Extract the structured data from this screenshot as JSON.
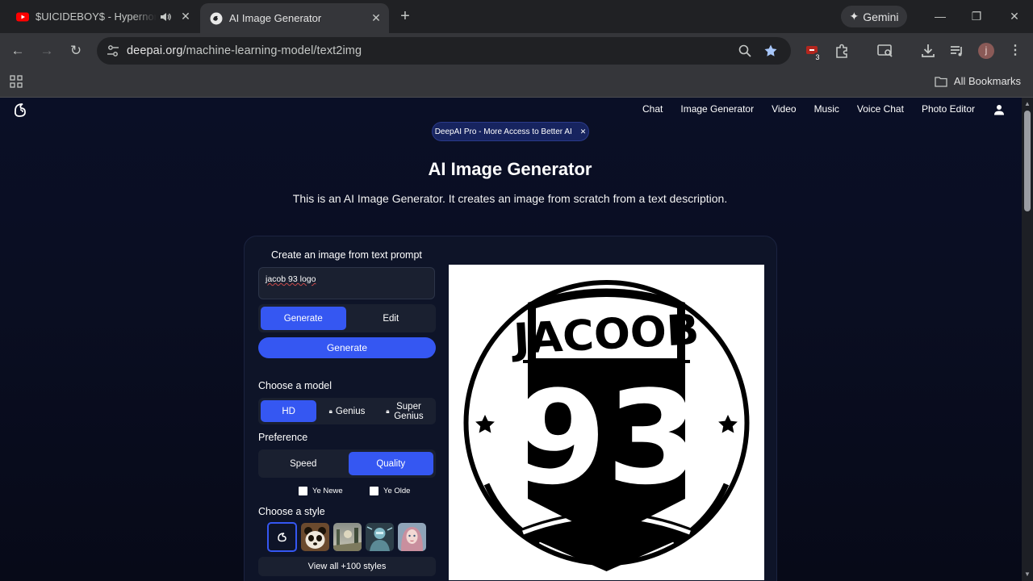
{
  "browser": {
    "tabs": [
      {
        "title": "$UICIDEBOY$ - Hypernormal",
        "active": false,
        "audio": true
      },
      {
        "title": "AI Image Generator",
        "active": true
      }
    ],
    "gemini_label": "Gemini",
    "url_host": "deepai.org",
    "url_path": "/machine-learning-model/text2img",
    "extension_badge": "3",
    "profile_initial": "j",
    "bookmarks_label": "All Bookmarks"
  },
  "site": {
    "nav": [
      "Chat",
      "Image Generator",
      "Video",
      "Music",
      "Voice Chat",
      "Photo Editor"
    ],
    "promo": "DeepAI Pro - More Access to Better AI",
    "title": "AI Image Generator",
    "description": "This is an AI Image Generator. It creates an image from scratch from a text description."
  },
  "generator": {
    "heading": "Create an image from text prompt",
    "prompt_value": "jacob 93 logo",
    "mode_tabs": {
      "generate": "Generate",
      "edit": "Edit"
    },
    "generate_button": "Generate",
    "model_label": "Choose a model",
    "models": {
      "hd": "HD",
      "genius": "Genius",
      "super_genius": "Super Genius"
    },
    "preference_label": "Preference",
    "preferences": {
      "speed": "Speed",
      "quality": "Quality"
    },
    "checkbox_newe": "Ye Newe",
    "checkbox_olde": "Ye Olde",
    "style_label": "Choose a style",
    "view_all": "View all +100 styles"
  },
  "result_image": {
    "banner_text": "JACOOB",
    "number_text": "93"
  },
  "colors": {
    "accent": "#3557f2",
    "page_bg": "#0a0f26"
  }
}
